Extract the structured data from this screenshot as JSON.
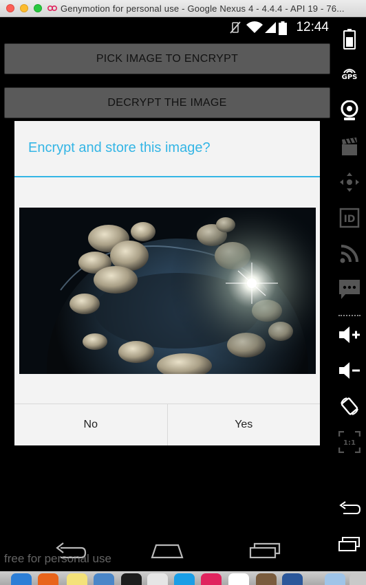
{
  "window": {
    "title": "Genymotion for personal use - Google Nexus 4 - 4.4.4 - API 19 - 76..."
  },
  "statusbar": {
    "time": "12:44"
  },
  "app": {
    "pick_button": "PICK IMAGE TO ENCRYPT",
    "decrypt_button": "DECRYPT THE IMAGE"
  },
  "dialog": {
    "title": "Encrypt and store this image?",
    "no_label": "No",
    "yes_label": "Yes",
    "accent_color": "#33b5e5"
  },
  "watermark": "free for personal use",
  "sidebar": {
    "gps_label": "GPS",
    "id_label": "ID",
    "pixel_label": "1:1"
  }
}
